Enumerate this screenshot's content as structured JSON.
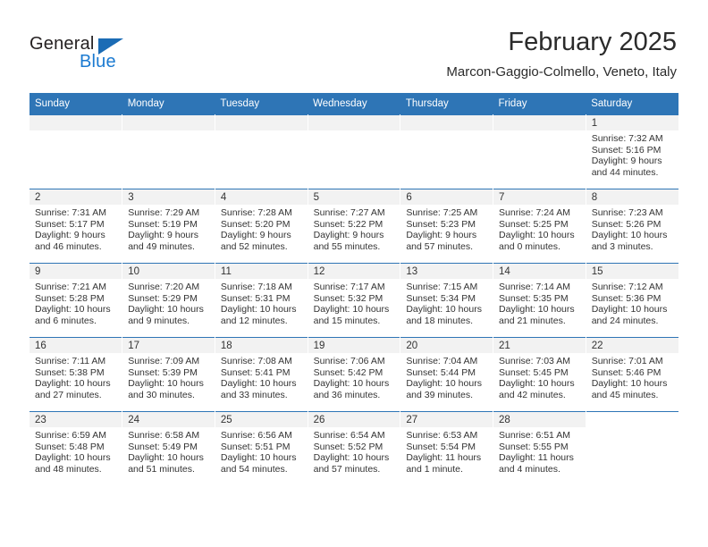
{
  "brand": {
    "name_part1": "General",
    "name_part2": "Blue",
    "triangle_color": "#1b6cb5",
    "blue_color": "#1b7ad1"
  },
  "header": {
    "month_title": "February 2025",
    "location": "Marcon-Gaggio-Colmello, Veneto, Italy"
  },
  "calendar": {
    "header_bg": "#2e75b6",
    "daynum_bg": "#f2f2f2",
    "weekday_headers": [
      "Sunday",
      "Monday",
      "Tuesday",
      "Wednesday",
      "Thursday",
      "Friday",
      "Saturday"
    ],
    "weeks": [
      [
        {
          "day": "",
          "sunrise": "",
          "sunset": "",
          "daylight_line1": "",
          "daylight_line2": "",
          "empty": true
        },
        {
          "day": "",
          "sunrise": "",
          "sunset": "",
          "daylight_line1": "",
          "daylight_line2": "",
          "empty": true
        },
        {
          "day": "",
          "sunrise": "",
          "sunset": "",
          "daylight_line1": "",
          "daylight_line2": "",
          "empty": true
        },
        {
          "day": "",
          "sunrise": "",
          "sunset": "",
          "daylight_line1": "",
          "daylight_line2": "",
          "empty": true
        },
        {
          "day": "",
          "sunrise": "",
          "sunset": "",
          "daylight_line1": "",
          "daylight_line2": "",
          "empty": true
        },
        {
          "day": "",
          "sunrise": "",
          "sunset": "",
          "daylight_line1": "",
          "daylight_line2": "",
          "empty": true
        },
        {
          "day": "1",
          "sunrise": "Sunrise: 7:32 AM",
          "sunset": "Sunset: 5:16 PM",
          "daylight_line1": "Daylight: 9 hours",
          "daylight_line2": "and 44 minutes."
        }
      ],
      [
        {
          "day": "2",
          "sunrise": "Sunrise: 7:31 AM",
          "sunset": "Sunset: 5:17 PM",
          "daylight_line1": "Daylight: 9 hours",
          "daylight_line2": "and 46 minutes."
        },
        {
          "day": "3",
          "sunrise": "Sunrise: 7:29 AM",
          "sunset": "Sunset: 5:19 PM",
          "daylight_line1": "Daylight: 9 hours",
          "daylight_line2": "and 49 minutes."
        },
        {
          "day": "4",
          "sunrise": "Sunrise: 7:28 AM",
          "sunset": "Sunset: 5:20 PM",
          "daylight_line1": "Daylight: 9 hours",
          "daylight_line2": "and 52 minutes."
        },
        {
          "day": "5",
          "sunrise": "Sunrise: 7:27 AM",
          "sunset": "Sunset: 5:22 PM",
          "daylight_line1": "Daylight: 9 hours",
          "daylight_line2": "and 55 minutes."
        },
        {
          "day": "6",
          "sunrise": "Sunrise: 7:25 AM",
          "sunset": "Sunset: 5:23 PM",
          "daylight_line1": "Daylight: 9 hours",
          "daylight_line2": "and 57 minutes."
        },
        {
          "day": "7",
          "sunrise": "Sunrise: 7:24 AM",
          "sunset": "Sunset: 5:25 PM",
          "daylight_line1": "Daylight: 10 hours",
          "daylight_line2": "and 0 minutes."
        },
        {
          "day": "8",
          "sunrise": "Sunrise: 7:23 AM",
          "sunset": "Sunset: 5:26 PM",
          "daylight_line1": "Daylight: 10 hours",
          "daylight_line2": "and 3 minutes."
        }
      ],
      [
        {
          "day": "9",
          "sunrise": "Sunrise: 7:21 AM",
          "sunset": "Sunset: 5:28 PM",
          "daylight_line1": "Daylight: 10 hours",
          "daylight_line2": "and 6 minutes."
        },
        {
          "day": "10",
          "sunrise": "Sunrise: 7:20 AM",
          "sunset": "Sunset: 5:29 PM",
          "daylight_line1": "Daylight: 10 hours",
          "daylight_line2": "and 9 minutes."
        },
        {
          "day": "11",
          "sunrise": "Sunrise: 7:18 AM",
          "sunset": "Sunset: 5:31 PM",
          "daylight_line1": "Daylight: 10 hours",
          "daylight_line2": "and 12 minutes."
        },
        {
          "day": "12",
          "sunrise": "Sunrise: 7:17 AM",
          "sunset": "Sunset: 5:32 PM",
          "daylight_line1": "Daylight: 10 hours",
          "daylight_line2": "and 15 minutes."
        },
        {
          "day": "13",
          "sunrise": "Sunrise: 7:15 AM",
          "sunset": "Sunset: 5:34 PM",
          "daylight_line1": "Daylight: 10 hours",
          "daylight_line2": "and 18 minutes."
        },
        {
          "day": "14",
          "sunrise": "Sunrise: 7:14 AM",
          "sunset": "Sunset: 5:35 PM",
          "daylight_line1": "Daylight: 10 hours",
          "daylight_line2": "and 21 minutes."
        },
        {
          "day": "15",
          "sunrise": "Sunrise: 7:12 AM",
          "sunset": "Sunset: 5:36 PM",
          "daylight_line1": "Daylight: 10 hours",
          "daylight_line2": "and 24 minutes."
        }
      ],
      [
        {
          "day": "16",
          "sunrise": "Sunrise: 7:11 AM",
          "sunset": "Sunset: 5:38 PM",
          "daylight_line1": "Daylight: 10 hours",
          "daylight_line2": "and 27 minutes."
        },
        {
          "day": "17",
          "sunrise": "Sunrise: 7:09 AM",
          "sunset": "Sunset: 5:39 PM",
          "daylight_line1": "Daylight: 10 hours",
          "daylight_line2": "and 30 minutes."
        },
        {
          "day": "18",
          "sunrise": "Sunrise: 7:08 AM",
          "sunset": "Sunset: 5:41 PM",
          "daylight_line1": "Daylight: 10 hours",
          "daylight_line2": "and 33 minutes."
        },
        {
          "day": "19",
          "sunrise": "Sunrise: 7:06 AM",
          "sunset": "Sunset: 5:42 PM",
          "daylight_line1": "Daylight: 10 hours",
          "daylight_line2": "and 36 minutes."
        },
        {
          "day": "20",
          "sunrise": "Sunrise: 7:04 AM",
          "sunset": "Sunset: 5:44 PM",
          "daylight_line1": "Daylight: 10 hours",
          "daylight_line2": "and 39 minutes."
        },
        {
          "day": "21",
          "sunrise": "Sunrise: 7:03 AM",
          "sunset": "Sunset: 5:45 PM",
          "daylight_line1": "Daylight: 10 hours",
          "daylight_line2": "and 42 minutes."
        },
        {
          "day": "22",
          "sunrise": "Sunrise: 7:01 AM",
          "sunset": "Sunset: 5:46 PM",
          "daylight_line1": "Daylight: 10 hours",
          "daylight_line2": "and 45 minutes."
        }
      ],
      [
        {
          "day": "23",
          "sunrise": "Sunrise: 6:59 AM",
          "sunset": "Sunset: 5:48 PM",
          "daylight_line1": "Daylight: 10 hours",
          "daylight_line2": "and 48 minutes."
        },
        {
          "day": "24",
          "sunrise": "Sunrise: 6:58 AM",
          "sunset": "Sunset: 5:49 PM",
          "daylight_line1": "Daylight: 10 hours",
          "daylight_line2": "and 51 minutes."
        },
        {
          "day": "25",
          "sunrise": "Sunrise: 6:56 AM",
          "sunset": "Sunset: 5:51 PM",
          "daylight_line1": "Daylight: 10 hours",
          "daylight_line2": "and 54 minutes."
        },
        {
          "day": "26",
          "sunrise": "Sunrise: 6:54 AM",
          "sunset": "Sunset: 5:52 PM",
          "daylight_line1": "Daylight: 10 hours",
          "daylight_line2": "and 57 minutes."
        },
        {
          "day": "27",
          "sunrise": "Sunrise: 6:53 AM",
          "sunset": "Sunset: 5:54 PM",
          "daylight_line1": "Daylight: 11 hours",
          "daylight_line2": "and 1 minute."
        },
        {
          "day": "28",
          "sunrise": "Sunrise: 6:51 AM",
          "sunset": "Sunset: 5:55 PM",
          "daylight_line1": "Daylight: 11 hours",
          "daylight_line2": "and 4 minutes."
        },
        {
          "day": "",
          "sunrise": "",
          "sunset": "",
          "daylight_line1": "",
          "daylight_line2": "",
          "blank": true
        }
      ]
    ]
  }
}
